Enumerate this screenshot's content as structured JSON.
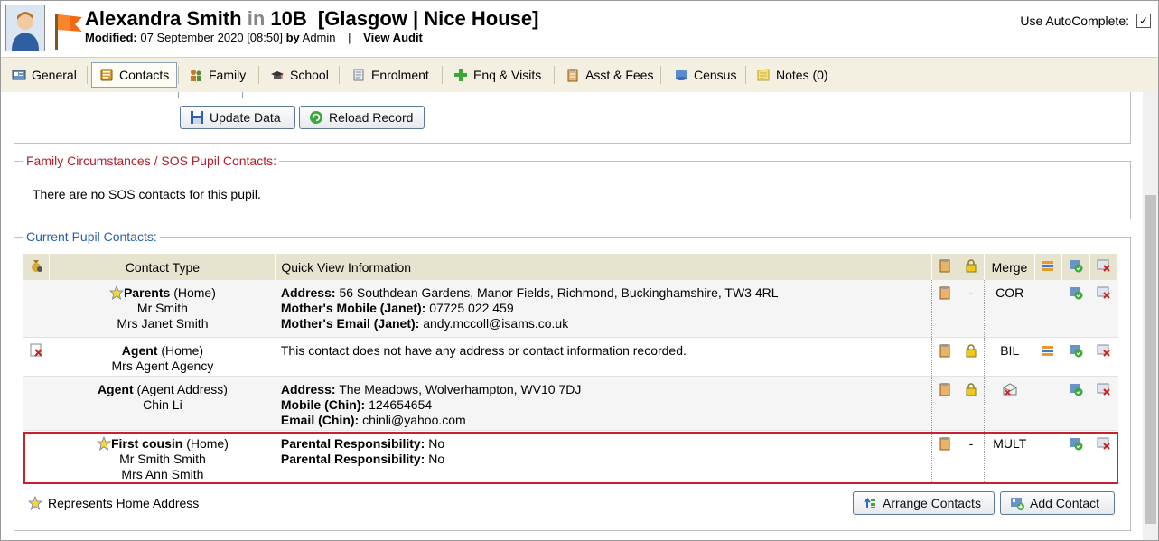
{
  "header": {
    "name": "Alexandra Smith",
    "in_word": "in",
    "form": "10B",
    "house": "[Glasgow | Nice House]",
    "modified_label": "Modified:",
    "modified_value": "07 September 2020 [08:50]",
    "by_word": "by",
    "by_user": "Admin",
    "separator": "|",
    "view_audit": "View Audit",
    "autocomplete_label": "Use AutoComplete:",
    "autocomplete_checked": true
  },
  "tabs": [
    {
      "label": "General",
      "icon": "general-icon"
    },
    {
      "label": "Contacts",
      "icon": "contacts-icon"
    },
    {
      "label": "Family",
      "icon": "family-icon"
    },
    {
      "label": "School",
      "icon": "school-icon"
    },
    {
      "label": "Enrolment",
      "icon": "enrolment-icon"
    },
    {
      "label": "Enq & Visits",
      "icon": "plus-icon"
    },
    {
      "label": "Asst & Fees",
      "icon": "fees-icon"
    },
    {
      "label": "Census",
      "icon": "census-icon"
    },
    {
      "label": "Notes (0)",
      "icon": "notes-icon"
    }
  ],
  "active_tab": "Contacts",
  "actions": {
    "update": "Update Data",
    "reload": "Reload Record"
  },
  "sos": {
    "legend": "Family Circumstances / SOS Pupil Contacts:",
    "message": "There are no SOS contacts for this pupil."
  },
  "current": {
    "legend": "Current Pupil Contacts:",
    "headers": {
      "contact_type": "Contact Type",
      "quick_view": "Quick View Information",
      "merge": "Merge"
    },
    "rows": [
      {
        "type": "Parents",
        "addr_type": "(Home)",
        "names": [
          "Mr Smith",
          "Mrs Janet Smith"
        ],
        "info": [
          {
            "label": "Address:",
            "value": "56 Southdean Gardens, Manor Fields, Richmond, Buckinghamshire, TW3 4RL"
          },
          {
            "label": "Mother's Mobile (Janet):",
            "value": "07725 022 459"
          },
          {
            "label": "Mother's Email (Janet):",
            "value": "andy.mccoll@isams.co.uk"
          }
        ],
        "lock": "-",
        "merge": "COR"
      },
      {
        "type": "Agent",
        "addr_type": "(Home)",
        "names": [
          "Mrs Agent Agency"
        ],
        "info_plain": "This contact does not have any address or contact information recorded.",
        "merge": "BIL"
      },
      {
        "type": "Agent",
        "addr_type": "(Agent Address)",
        "names": [
          "Chin Li"
        ],
        "info": [
          {
            "label": "Address:",
            "value": "The Meadows, Wolverhampton, WV10 7DJ"
          },
          {
            "label": "Mobile (Chin):",
            "value": "124654654"
          },
          {
            "label": "Email (Chin):",
            "value": "chinli@yahoo.com"
          }
        ]
      },
      {
        "type": "First cousin",
        "addr_type": "(Home)",
        "names": [
          "Mr Smith Smith",
          "Mrs Ann Smith"
        ],
        "info": [
          {
            "label": "Parental Responsibility:",
            "value": "No"
          },
          {
            "label": "Parental Responsibility:",
            "value": "No"
          }
        ],
        "lock": "-",
        "merge": "MULT"
      }
    ],
    "home_legend": "Represents Home Address",
    "arrange_button": "Arrange Contacts",
    "add_button": "Add Contact"
  },
  "colors": {
    "tab_bar": "#f3f0e1",
    "table_header": "#e6e3cf",
    "highlight_border": "#c8202e",
    "sos_legend": "#b0202a",
    "current_legend": "#2a5fa8"
  }
}
